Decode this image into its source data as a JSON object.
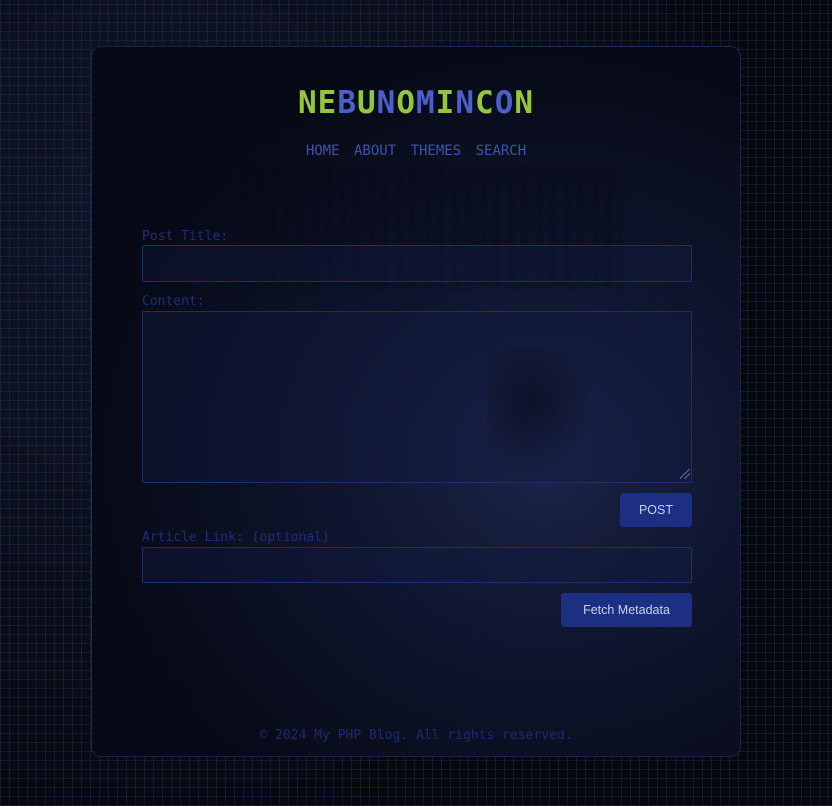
{
  "header": {
    "site_title_letters": [
      {
        "ch": "N",
        "color": "#93c83c"
      },
      {
        "ch": "E",
        "color": "#93c83c"
      },
      {
        "ch": "B",
        "color": "#4a5fc8"
      },
      {
        "ch": "U",
        "color": "#93c83c"
      },
      {
        "ch": "N",
        "color": "#4a5fc8"
      },
      {
        "ch": "O",
        "color": "#93c83c"
      },
      {
        "ch": "M",
        "color": "#4a5fc8"
      },
      {
        "ch": "I",
        "color": "#93c83c"
      },
      {
        "ch": "N",
        "color": "#4a5fc8"
      },
      {
        "ch": "C",
        "color": "#93c83c"
      },
      {
        "ch": "O",
        "color": "#4a5fc8"
      },
      {
        "ch": "N",
        "color": "#93c83c"
      }
    ]
  },
  "nav": {
    "items": [
      "HOME",
      "ABOUT",
      "THEMES",
      "SEARCH"
    ]
  },
  "form": {
    "title_label": "Post Title:",
    "title_value": "",
    "content_label": "Content:",
    "content_value": "",
    "post_button": "POST",
    "link_label": "Article Link: (optional)",
    "link_value": "",
    "fetch_button": "Fetch Metadata"
  },
  "footer": {
    "text": "© 2024 My PHP Blog. All rights reserved."
  },
  "colors": {
    "accent_green": "#93c83c",
    "accent_blue": "#4a5fc8",
    "button_bg": "#1c2f83"
  }
}
